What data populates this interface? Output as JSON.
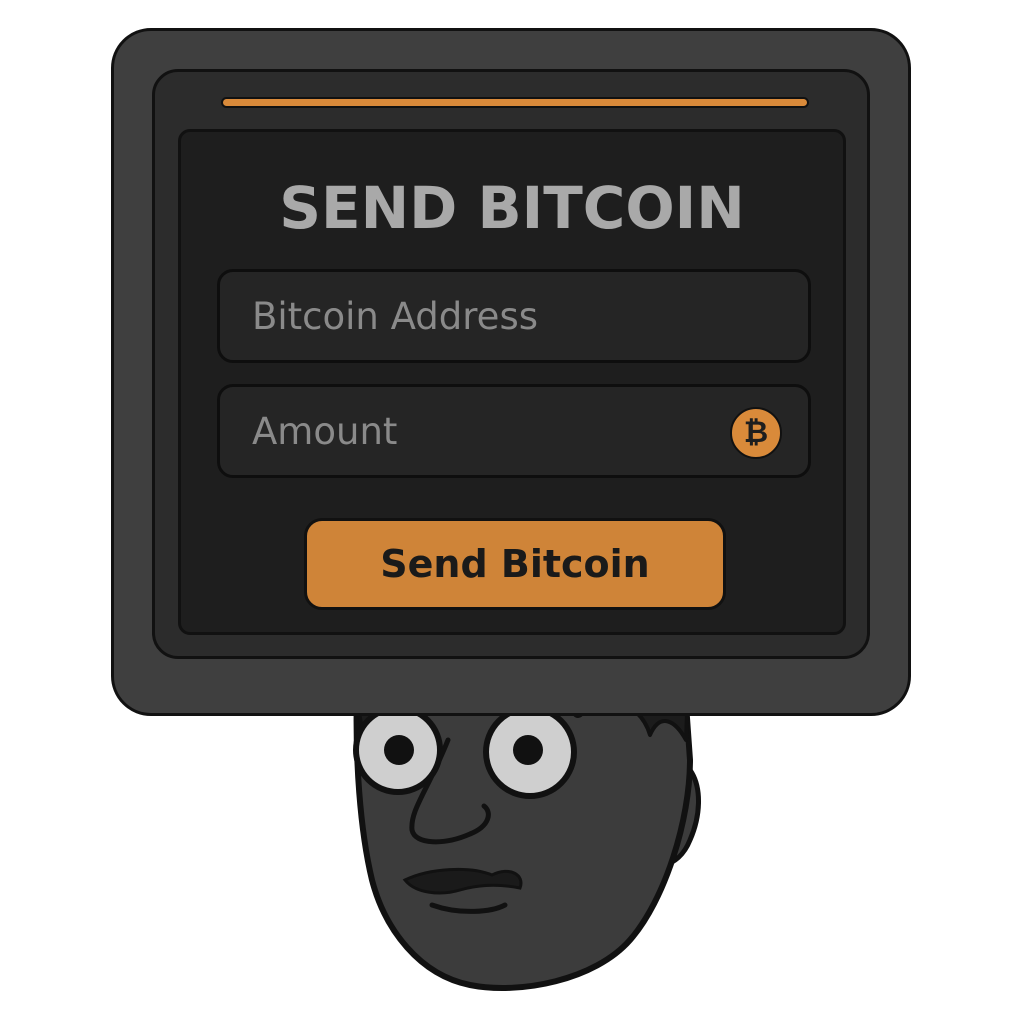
{
  "window": {
    "title": "SEND BITCOIN"
  },
  "form": {
    "address_placeholder": "Bitcoin Address",
    "address_value": "",
    "amount_placeholder": "Amount",
    "amount_value": "",
    "currency_icon": "bitcoin-icon",
    "currency_symbol": "₿",
    "send_label": "Send Bitcoin"
  },
  "colors": {
    "accent": "#d98a3a",
    "button": "#cf8438",
    "screen": "#1e1e1e",
    "frame": "#3f3f3f",
    "title_text": "#a9a9a9",
    "placeholder_text": "#8a8a8a"
  }
}
